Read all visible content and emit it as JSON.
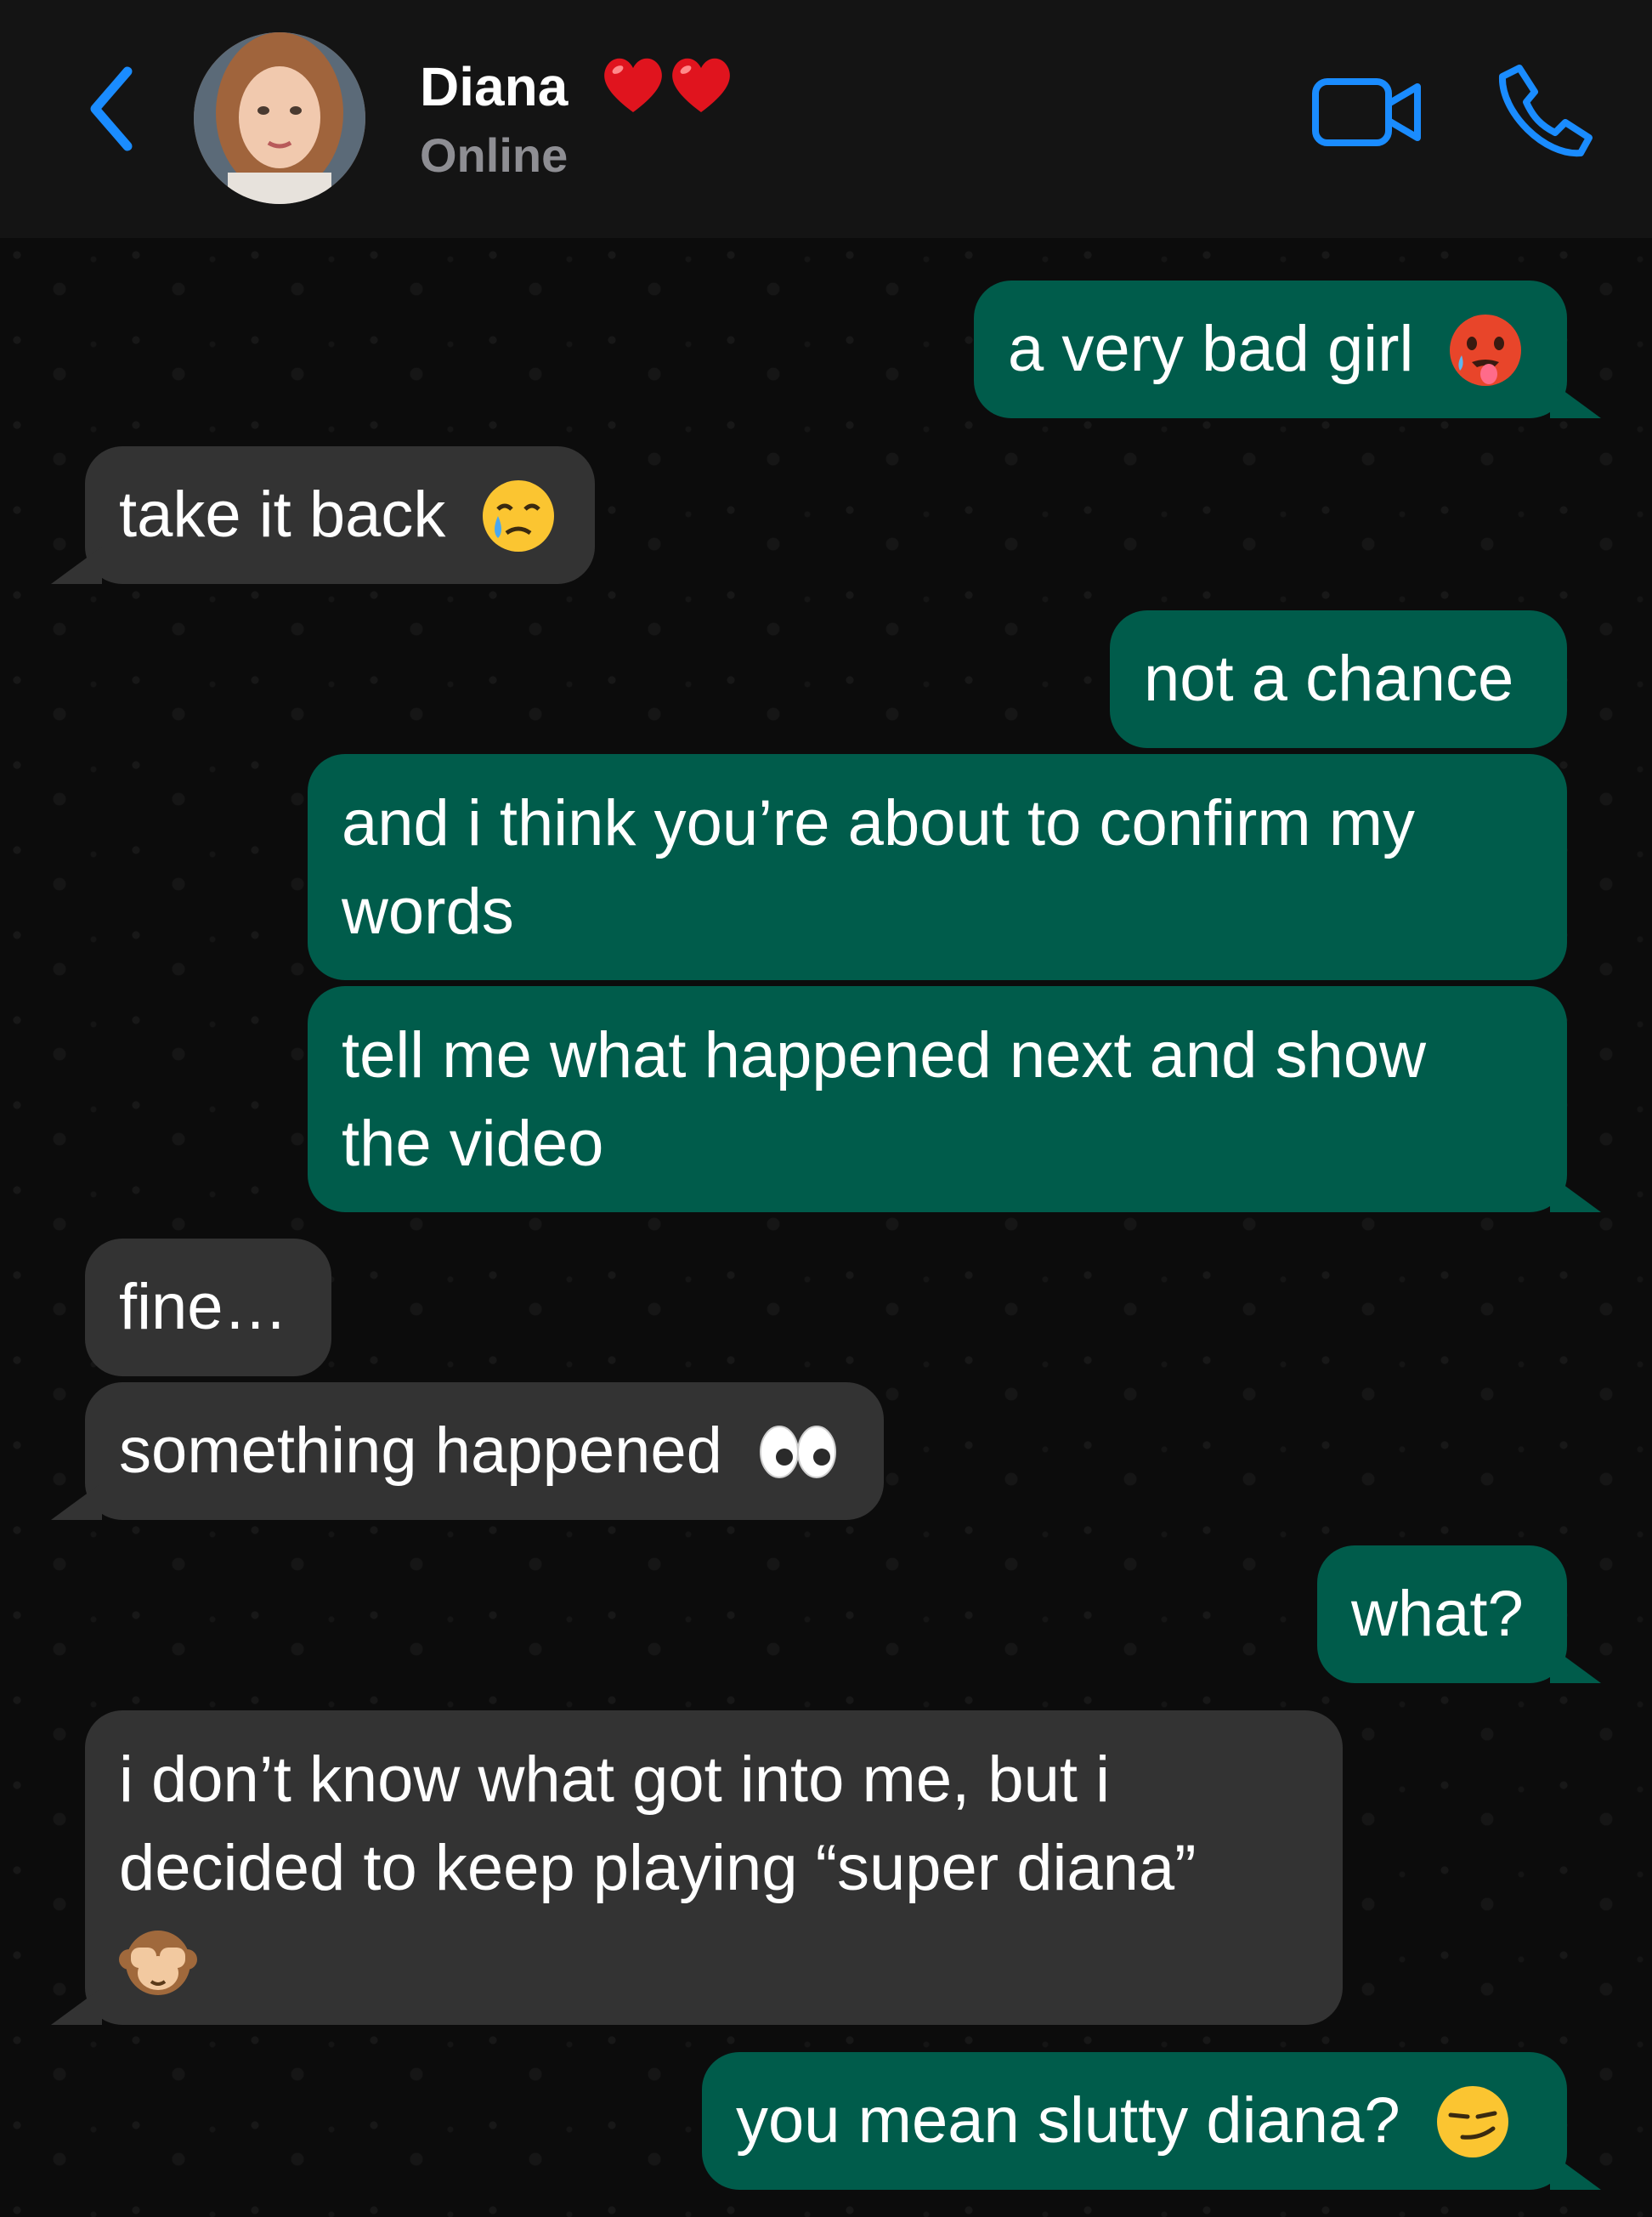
{
  "header": {
    "contact_name": "Diana",
    "status": "Online",
    "name_emoji": "❤️❤️",
    "icons": {
      "back": "chevron-left-icon",
      "video": "video-camera-icon",
      "call": "phone-icon"
    }
  },
  "colors": {
    "accent": "#1a8cff",
    "outgoing_bubble": "#005c4b",
    "incoming_bubble": "#333333",
    "background": "#0c0c0c",
    "header_background": "#141414",
    "status_text": "#8e8e93"
  },
  "messages": [
    {
      "direction": "out",
      "text": "a very bad girl",
      "emoji": "🥵"
    },
    {
      "direction": "in",
      "text": "take it back",
      "emoji": "😢"
    },
    {
      "direction": "out",
      "text": "not a chance"
    },
    {
      "direction": "out",
      "text": "and i think you’re about to confirm my words"
    },
    {
      "direction": "out",
      "text": "tell me what happened next and show the video"
    },
    {
      "direction": "in",
      "text": "fine…"
    },
    {
      "direction": "in",
      "text": "something happened",
      "emoji": "👀"
    },
    {
      "direction": "out",
      "text": "what?"
    },
    {
      "direction": "in",
      "text": "i don’t know what got into me, but i decided to keep playing “super diana”",
      "emoji": "🙈"
    },
    {
      "direction": "out",
      "text": "you mean slutty diana?",
      "emoji": "😏"
    }
  ]
}
